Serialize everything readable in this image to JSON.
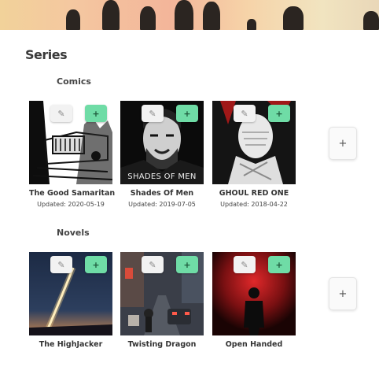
{
  "page": {
    "title": "Series"
  },
  "sections": [
    {
      "title": "Comics",
      "add_label": "+",
      "items": [
        {
          "title": "The Good Samaritan",
          "updated": "Updated: 2020-05-19",
          "edit_icon": "pencil-icon",
          "add_label": "+"
        },
        {
          "title": "Shades Of Men",
          "updated": "Updated: 2019-07-05",
          "cover_text": "SHADES OF MEN",
          "edit_icon": "pencil-icon",
          "add_label": "+"
        },
        {
          "title": "GHOUL RED ONE",
          "updated": "Updated: 2018-04-22",
          "edit_icon": "pencil-icon",
          "add_label": "+"
        }
      ]
    },
    {
      "title": "Novels",
      "add_label": "+",
      "items": [
        {
          "title": "The HighJacker",
          "edit_icon": "pencil-icon",
          "add_label": "+"
        },
        {
          "title": "Twisting Dragon",
          "edit_icon": "pencil-icon",
          "add_label": "+"
        },
        {
          "title": "Open Handed",
          "edit_icon": "pencil-icon",
          "add_label": "+"
        }
      ]
    }
  ]
}
